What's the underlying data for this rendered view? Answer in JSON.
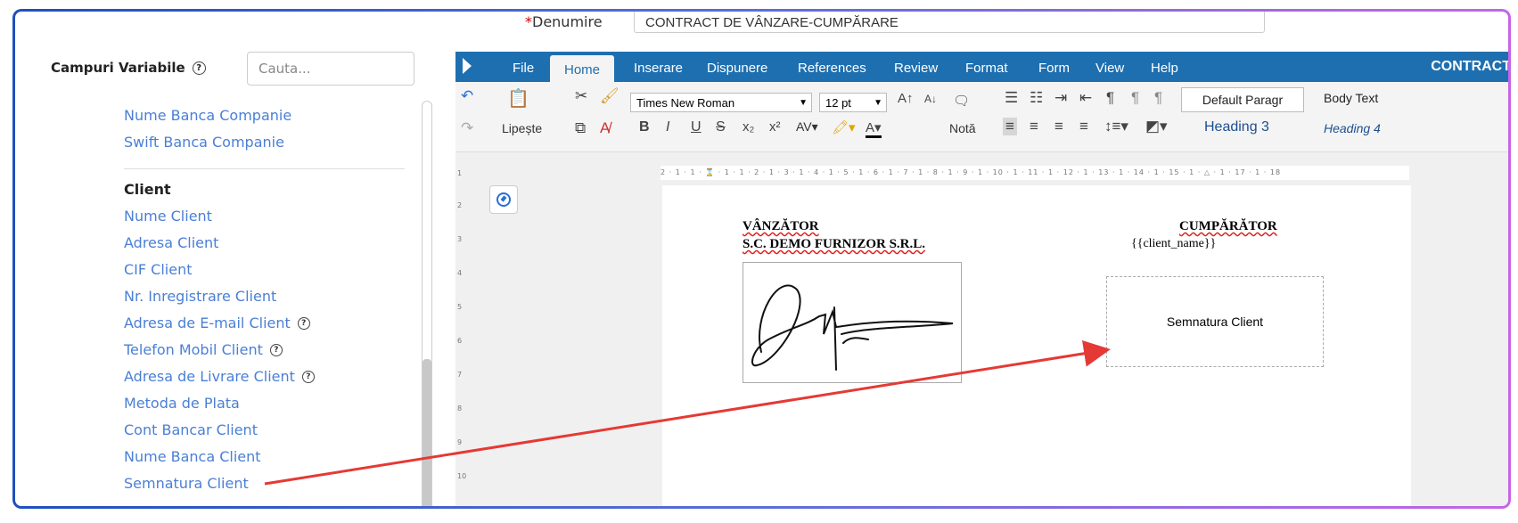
{
  "header": {
    "denumire_label": "Denumire",
    "denumire_required": "*",
    "denumire_value": "CONTRACT DE VÂNZARE-CUMPĂRARE"
  },
  "left_panel": {
    "title": "Campuri Variabile",
    "help_icon": "?",
    "search_placeholder": "Cauta...",
    "company_items": [
      "Nume Banca Companie",
      "Swift Banca Companie"
    ],
    "client_group": "Client",
    "client_items": [
      {
        "label": "Nume Client",
        "help": ""
      },
      {
        "label": "Adresa Client",
        "help": ""
      },
      {
        "label": "CIF Client",
        "help": ""
      },
      {
        "label": "Nr. Inregistrare Client",
        "help": ""
      },
      {
        "label": "Adresa de E-mail Client",
        "help": "?"
      },
      {
        "label": "Telefon Mobil Client",
        "help": "?"
      },
      {
        "label": "Adresa de Livrare Client",
        "help": "?"
      },
      {
        "label": "Metoda de Plata",
        "help": ""
      },
      {
        "label": "Cont Bancar Client",
        "help": ""
      },
      {
        "label": "Nume Banca Client",
        "help": ""
      },
      {
        "label": "Semnatura Client",
        "help": ""
      }
    ]
  },
  "editor": {
    "tabs": [
      "File",
      "Home",
      "Inserare",
      "Dispunere",
      "References",
      "Review",
      "Format",
      "Form",
      "View",
      "Help"
    ],
    "active_tab": "Home",
    "doc_title": "CONTRACT D",
    "ribbon": {
      "paste_label": "Lipește",
      "font_name": "Times New Roman",
      "font_size": "12 pt",
      "note_label": "Notă",
      "format_buttons": [
        "B",
        "I",
        "U",
        "S",
        "x₂",
        "x²"
      ],
      "styles": [
        "Default Paragr",
        "Body Text",
        "Heading 3",
        "Heading 4"
      ]
    },
    "ruler_top": "2 · 1 · 1 · ⌛ · 1 · 1 · 2 · 1 · 3 · 1 · 4 · 1 · 5 · 1 · 6 · 1 · 7 · 1 · 8 · 1 · 9 · 1 · 10 · 1 · 11 · 1 · 12 · 1 · 13 · 1 · 14 · 1 · 15 · 1 · △ · 1 · 17 · 1 · 18",
    "ruler_left": [
      "1",
      "2",
      "3",
      "4",
      "5",
      "6",
      "7",
      "8",
      "9",
      "10"
    ],
    "document": {
      "seller_heading": "VÂNZĂTOR",
      "seller_name": "S.C. DEMO FURNIZOR S.R.L.",
      "buyer_heading": "CUMPĂRĂTOR",
      "buyer_placeholder": "{{client_name}}",
      "signature_box_label": "Semnatura Client"
    }
  },
  "colors": {
    "accent": "#1e6fb0",
    "link": "#4a7fd6",
    "arrow": "#e53935"
  }
}
